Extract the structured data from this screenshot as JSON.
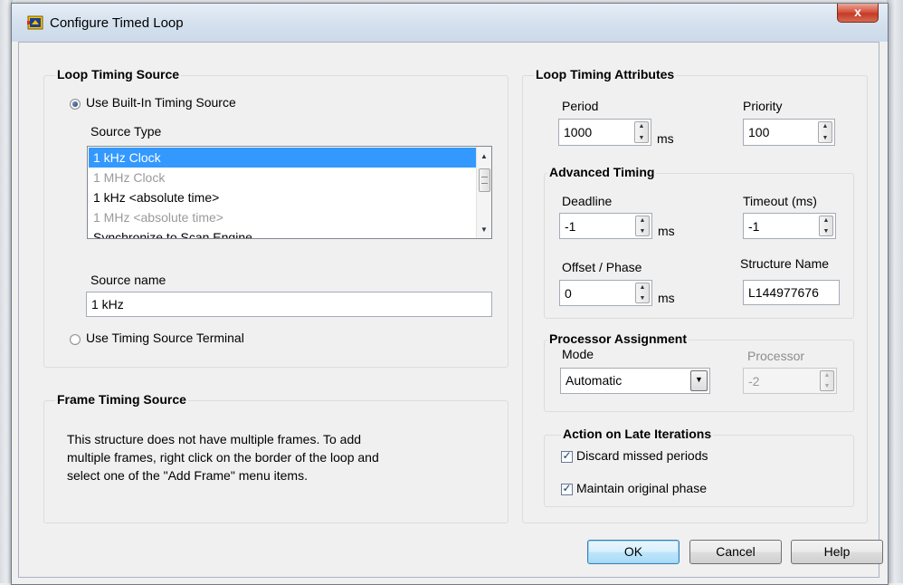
{
  "window": {
    "title": "Configure Timed Loop",
    "close_label": "x"
  },
  "loop_timing_source": {
    "title": "Loop Timing Source",
    "builtin_radio_label": "Use Built-In Timing Source",
    "builtin_selected": true,
    "source_type_label": "Source Type",
    "source_types": [
      {
        "label": "1 kHz Clock",
        "state": "selected"
      },
      {
        "label": "1 MHz Clock",
        "state": "disabled"
      },
      {
        "label": "1 kHz <absolute time>",
        "state": "normal"
      },
      {
        "label": "1 MHz <absolute time>",
        "state": "disabled"
      },
      {
        "label": "Synchronize to Scan Engine",
        "state": "normal"
      }
    ],
    "source_name_label": "Source name",
    "source_name_value": "1 kHz",
    "terminal_radio_label": "Use Timing Source Terminal",
    "terminal_selected": false
  },
  "frame_timing_source": {
    "title": "Frame Timing Source",
    "description_lines": [
      "This structure does not have multiple frames. To add",
      "multiple frames, right click on the border of the loop and",
      "select one of the \"Add Frame\" menu items."
    ]
  },
  "loop_timing_attributes": {
    "title": "Loop Timing Attributes",
    "period_label": "Period",
    "period_value": "1000",
    "period_unit": "ms",
    "priority_label": "Priority",
    "priority_value": "100"
  },
  "advanced_timing": {
    "title": "Advanced Timing",
    "deadline_label": "Deadline",
    "deadline_value": "-1",
    "deadline_unit": "ms",
    "timeout_label": "Timeout (ms)",
    "timeout_value": "-1",
    "offset_label": "Offset / Phase",
    "offset_value": "0",
    "offset_unit": "ms",
    "structure_name_label": "Structure Name",
    "structure_name_value": "L144977676"
  },
  "processor_assignment": {
    "title": "Processor Assignment",
    "mode_label": "Mode",
    "mode_value": "Automatic",
    "processor_label": "Processor",
    "processor_value": "-2"
  },
  "late_iterations": {
    "title": "Action on Late Iterations",
    "discard_label": "Discard missed periods",
    "discard_checked": true,
    "maintain_label": "Maintain original phase",
    "maintain_checked": true
  },
  "buttons": {
    "ok": "OK",
    "cancel": "Cancel",
    "help": "Help"
  },
  "icons": {
    "window_icon": "labview-timed-loop-icon",
    "checkmark": "✓",
    "spin_up": "▲",
    "spin_down": "▼",
    "dropdown": "▼"
  },
  "colors": {
    "selection": "#3399ff",
    "close_button": "#c43b26",
    "default_button_border": "#3c7fb1"
  }
}
